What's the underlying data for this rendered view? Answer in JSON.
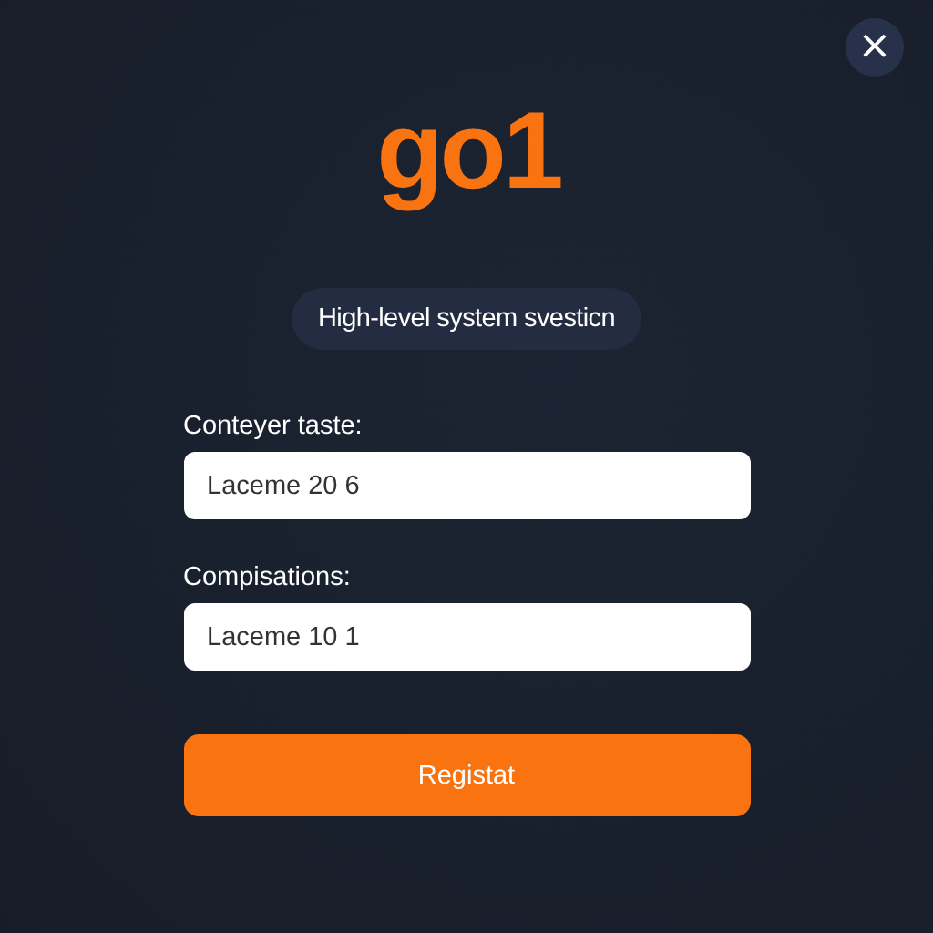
{
  "close_button": {
    "label": "×"
  },
  "logo": "go1",
  "subtitle": "High-level system svesticn",
  "fields": [
    {
      "label": "Conteyer taste:",
      "value": "Laceme 20 6"
    },
    {
      "label": "Compisations:",
      "value": "Laceme 10 1"
    }
  ],
  "submit_button": {
    "label": "Registat"
  }
}
